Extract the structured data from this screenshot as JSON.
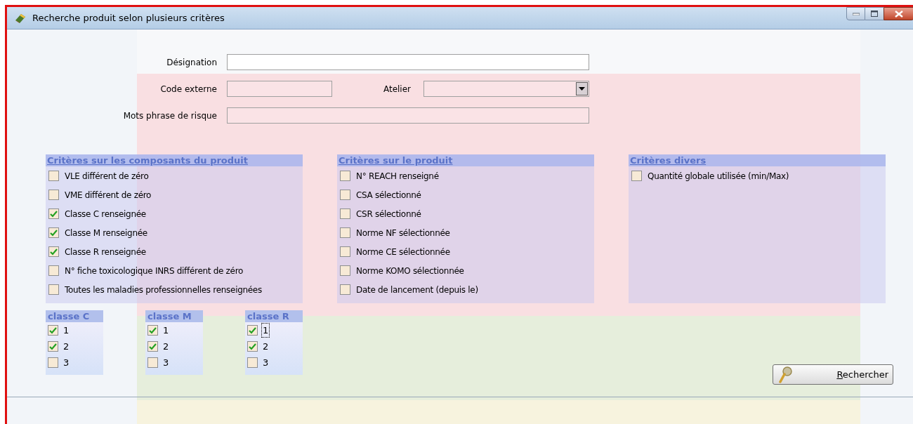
{
  "window": {
    "title": "Recherche produit selon plusieurs critères"
  },
  "form_rows": [
    [
      {
        "kind": "text",
        "label": "Désignation"
      }
    ],
    [
      {
        "kind": "text",
        "label": "Code externe"
      },
      {
        "kind": "select",
        "label": "Atelier"
      }
    ],
    [
      {
        "kind": "text",
        "label": "Mots phrase de risque"
      }
    ]
  ],
  "groups": [
    {
      "title": "Critères sur les composants du produit",
      "items": [
        {
          "label": "VLE différent de zéro",
          "checked": false
        },
        {
          "label": "VME différent de zéro",
          "checked": false
        },
        {
          "label": "Classe C renseignée",
          "checked": true
        },
        {
          "label": "Classe M renseignée",
          "checked": true
        },
        {
          "label": "Classe R renseignée",
          "checked": true
        },
        {
          "label": "N° fiche toxicologique INRS différent de zéro",
          "checked": false
        },
        {
          "label": "Toutes les maladies professionnelles renseignées",
          "checked": false
        }
      ]
    },
    {
      "title": "Critères sur le produit",
      "items": [
        {
          "label": "N° REACH renseigné",
          "checked": false
        },
        {
          "label": "CSA sélectionné",
          "checked": false
        },
        {
          "label": "CSR sélectionné",
          "checked": false
        },
        {
          "label": "Norme NF sélectionnée",
          "checked": false
        },
        {
          "label": "Norme CE sélectionnée",
          "checked": false
        },
        {
          "label": "Norme KOMO sélectionnée",
          "checked": false
        },
        {
          "label": "Date de lancement (depuis le)",
          "checked": false
        }
      ]
    },
    {
      "title": "Critères divers",
      "items": [
        {
          "label": "Quantité globale utilisée (min/Max)",
          "checked": false
        }
      ]
    }
  ],
  "classes": [
    {
      "title": "classe C",
      "items": [
        {
          "label": "1",
          "checked": true,
          "focused": false
        },
        {
          "label": "2",
          "checked": true,
          "focused": false
        },
        {
          "label": "3",
          "checked": false,
          "focused": false
        }
      ]
    },
    {
      "title": "classe M",
      "items": [
        {
          "label": "1",
          "checked": true,
          "focused": false
        },
        {
          "label": "2",
          "checked": true,
          "focused": false
        },
        {
          "label": "3",
          "checked": false,
          "focused": false
        }
      ]
    },
    {
      "title": "classe R",
      "items": [
        {
          "label": "1",
          "checked": true,
          "focused": true
        },
        {
          "label": "2",
          "checked": true,
          "focused": false
        },
        {
          "label": "3",
          "checked": false,
          "focused": false
        }
      ]
    }
  ],
  "search_button": {
    "label": "Rechercher"
  }
}
